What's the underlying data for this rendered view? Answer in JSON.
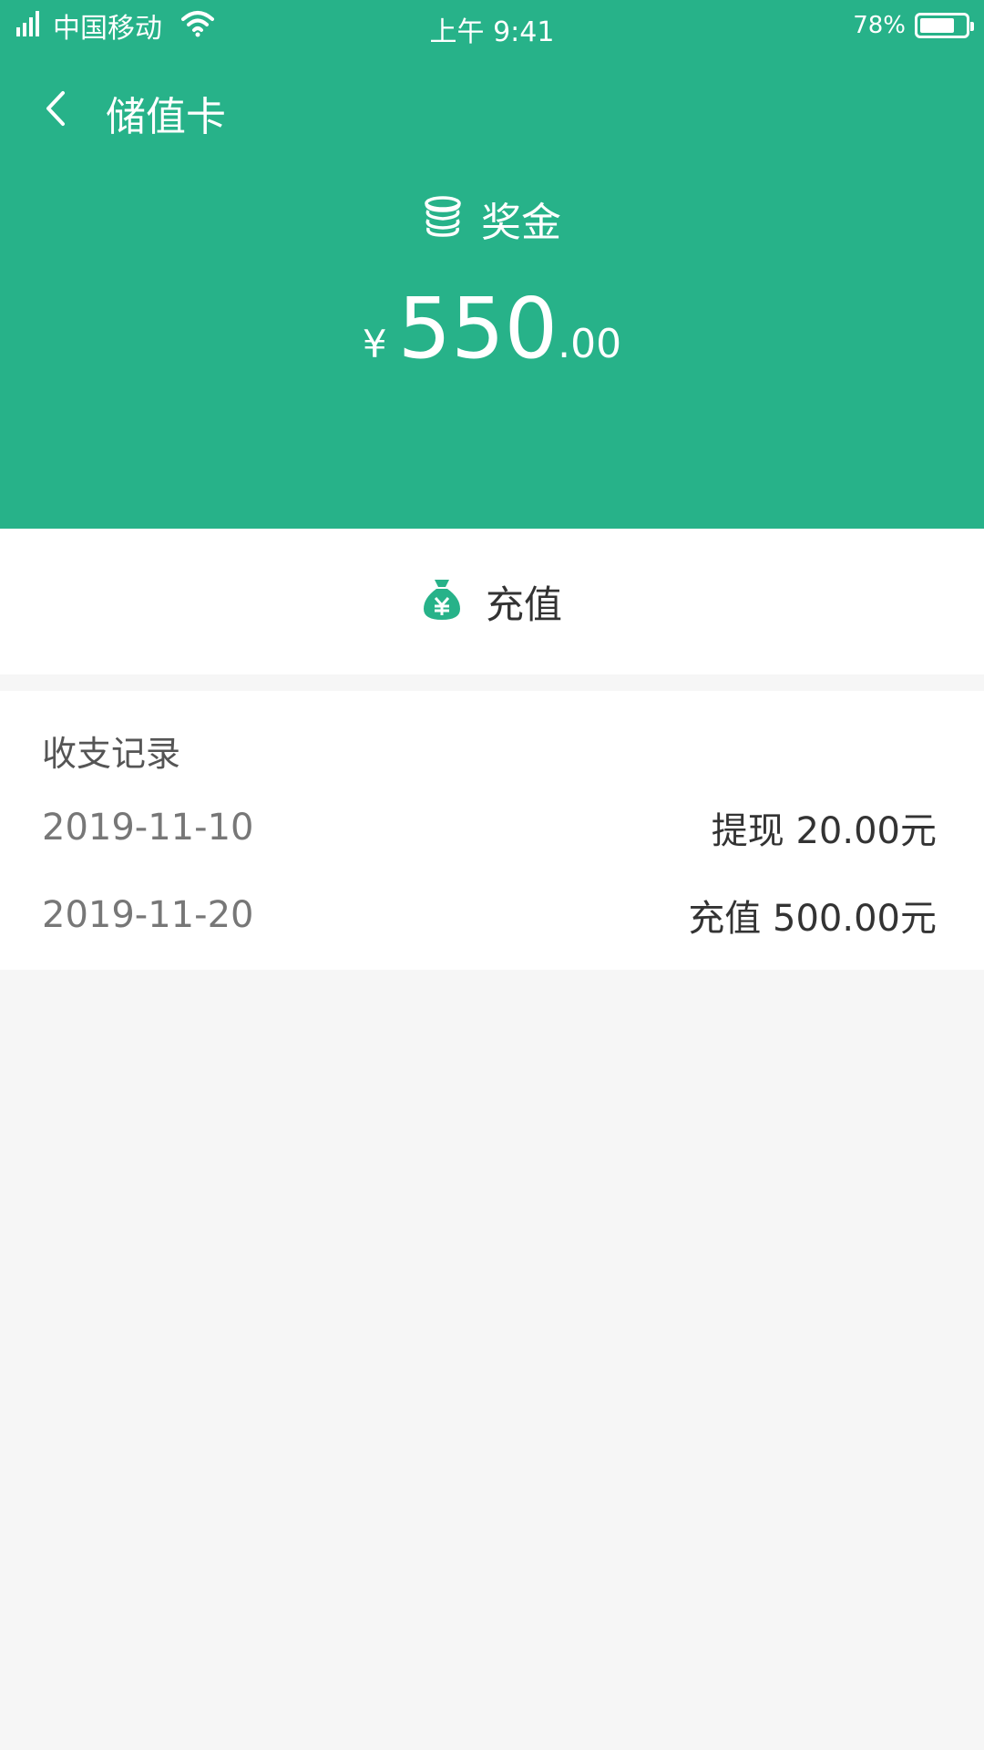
{
  "status_bar": {
    "carrier": "中国移动",
    "time": "上午 9:41",
    "battery_percent": "78%",
    "battery_level": 0.78,
    "signal_icon": "signal-icon",
    "wifi_icon": "wifi-icon",
    "battery_icon": "battery-icon"
  },
  "header": {
    "back_icon": "chevron-left-icon",
    "title": "储值卡"
  },
  "balance": {
    "icon": "coins-icon",
    "label": "奖金",
    "currency": "¥",
    "integer": "550",
    "decimal": ".00"
  },
  "recharge": {
    "icon": "money-bag-icon",
    "label": "充值"
  },
  "records": {
    "title": "收支记录",
    "items": [
      {
        "date": "2019-11-10",
        "amount": "提现 20.00元"
      },
      {
        "date": "2019-11-20",
        "amount": "充值 500.00元"
      }
    ]
  },
  "colors": {
    "primary": "#27b289",
    "background": "#f6f6f6"
  }
}
